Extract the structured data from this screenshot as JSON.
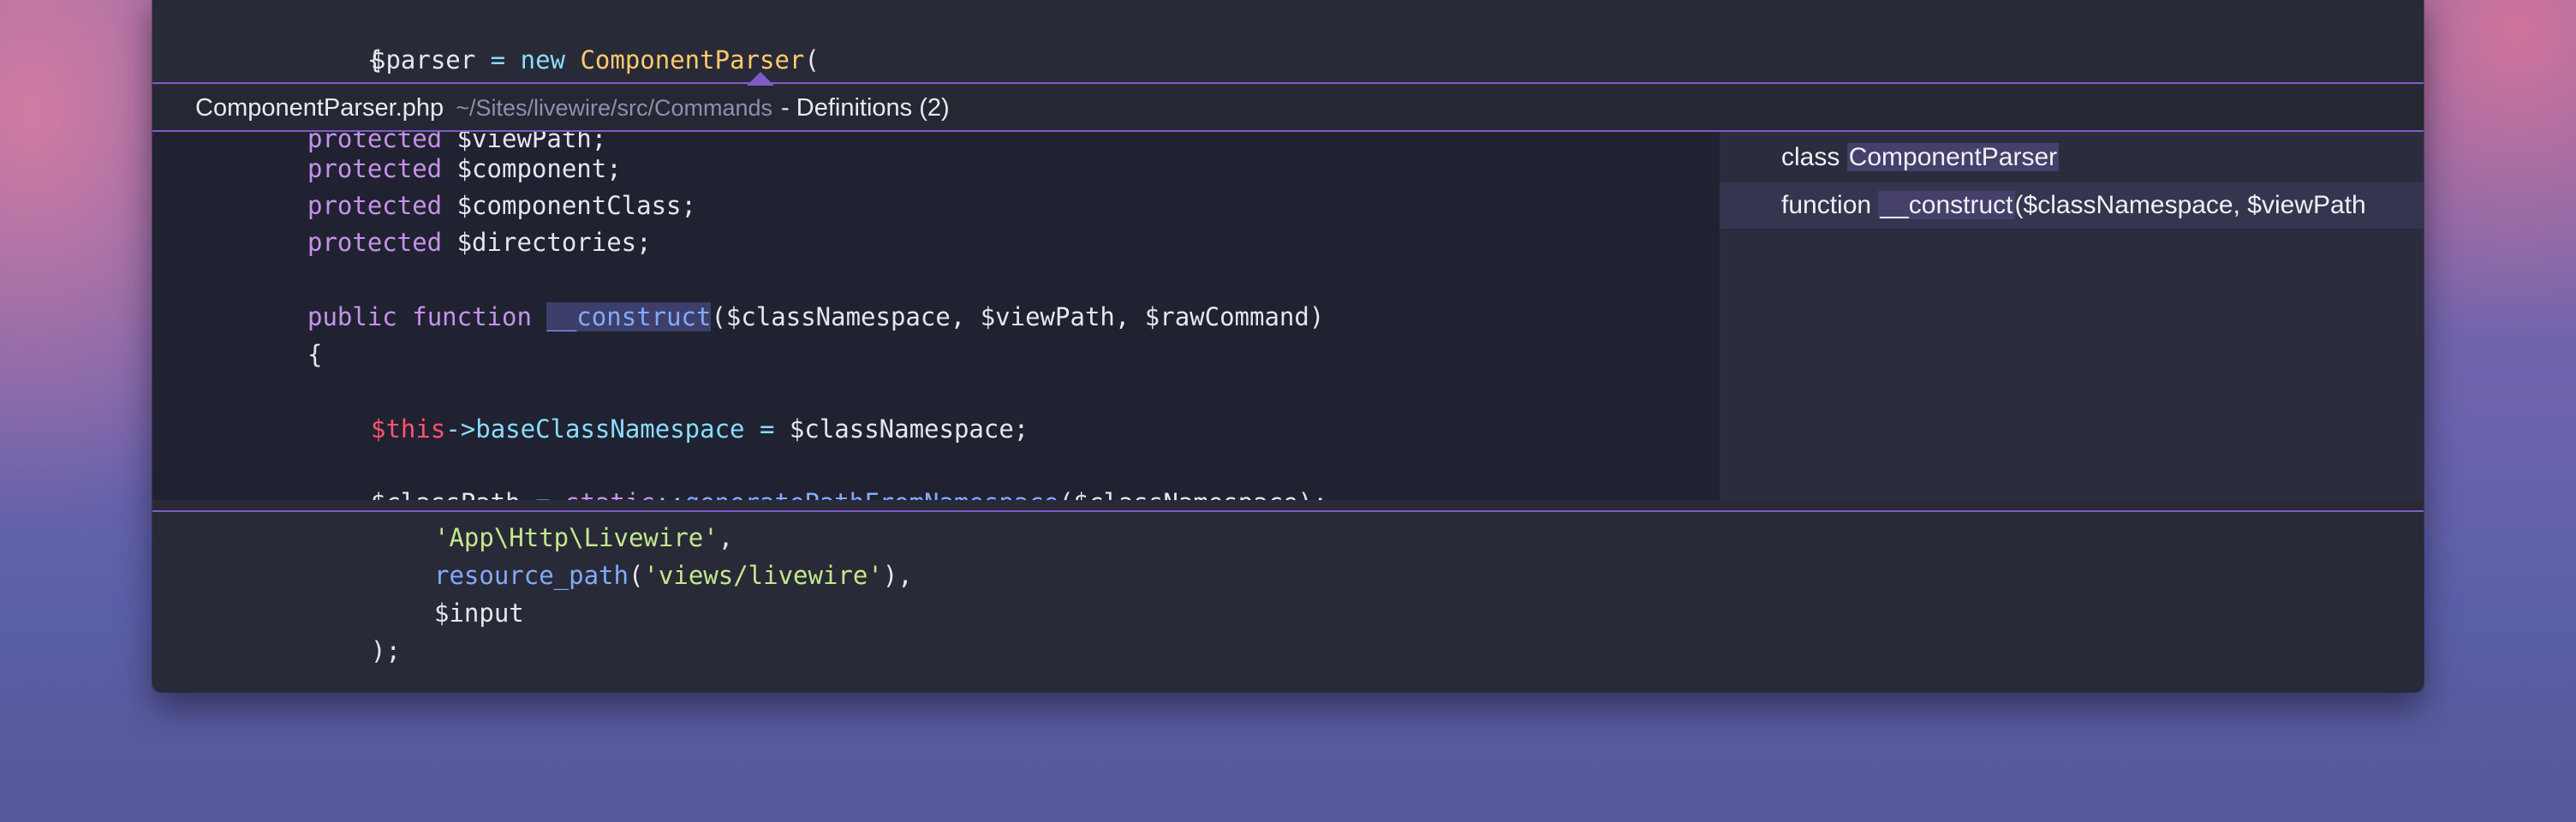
{
  "colors": {
    "editor_bg": "#292a37",
    "peek_bg": "#202231",
    "peek_border": "#7d5cc9",
    "keyword": "#c792ea",
    "function": "#82aaff",
    "class": "#ffcb6b",
    "this": "#ff5370",
    "string": "#c3e88d"
  },
  "top_code": {
    "line1_brace": "{",
    "line2": {
      "var": "$parser",
      "eq": " = ",
      "kw_new": "new",
      "space": " ",
      "cls": "ComponentParser",
      "paren": "("
    }
  },
  "peek": {
    "file_name": "ComponentParser.php",
    "file_path": "~/Sites/livewire/src/Commands",
    "title_suffix": "- Definitions (2)",
    "code": {
      "l0_kw": "protected",
      "l0_var": " $viewPath;",
      "l1_kw": "protected",
      "l1_var": " $component;",
      "l2_kw": "protected",
      "l2_var": " $componentClass;",
      "l3_kw": "protected",
      "l3_var": " $directories;",
      "l5_kw1": "public",
      "l5_kw2": "function",
      "l5_fn": "__construct",
      "l5_args": "($classNamespace, $viewPath, $rawCommand)",
      "l6_brace": "{",
      "l8_this": "$this",
      "l8_arrow": "->",
      "l8_prop": "baseClassNamespace",
      "l8_eq": " = ",
      "l8_rest": "$classNamespace;",
      "l10_var": "$classPath",
      "l10_eq": " = ",
      "l10_kw": "static",
      "l10_op": "::",
      "l10_fn": "generatePathFromNamespace",
      "l10_rest": "($classNamespace);"
    },
    "references": [
      {
        "kind": "class",
        "name": "ComponentParser",
        "rest": ""
      },
      {
        "kind": "function",
        "name": "__construct",
        "rest": "($classNamespace, $viewPath"
      }
    ]
  },
  "bottom_code": {
    "l1_str": "'App\\Http\\Livewire'",
    "l1_comma": ",",
    "l2_fn": "resource_path",
    "l2_open": "(",
    "l2_str": "'views/livewire'",
    "l2_close": "),",
    "l3_var": "$input",
    "l4": ");"
  }
}
